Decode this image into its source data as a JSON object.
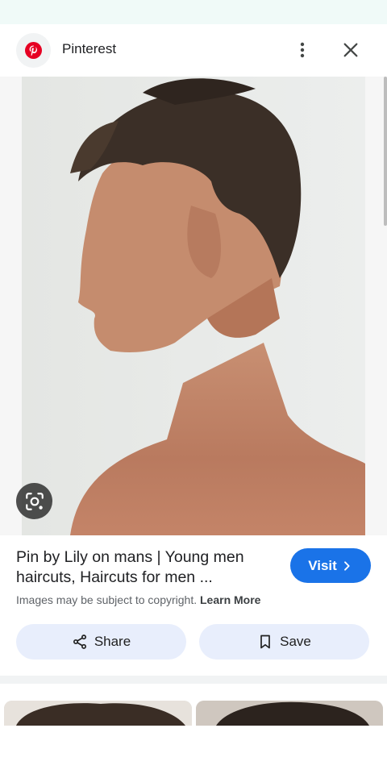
{
  "header": {
    "site_name": "Pinterest",
    "site_icon": "pinterest-logo",
    "more_icon": "more-vert-icon",
    "close_icon": "close-icon"
  },
  "image": {
    "lens_icon": "lens-search-icon"
  },
  "result": {
    "title": "Pin by Lily on mans | Young men haircuts, Haircuts for men ...",
    "copyright_text": "Images may be subject to copyright.",
    "learn_more": "Learn More",
    "visit_label": "Visit"
  },
  "actions": {
    "share_label": "Share",
    "save_label": "Save"
  },
  "colors": {
    "accent": "#1a73e8",
    "pinterest_red": "#e60023",
    "pill_bg": "#e8eefc"
  }
}
